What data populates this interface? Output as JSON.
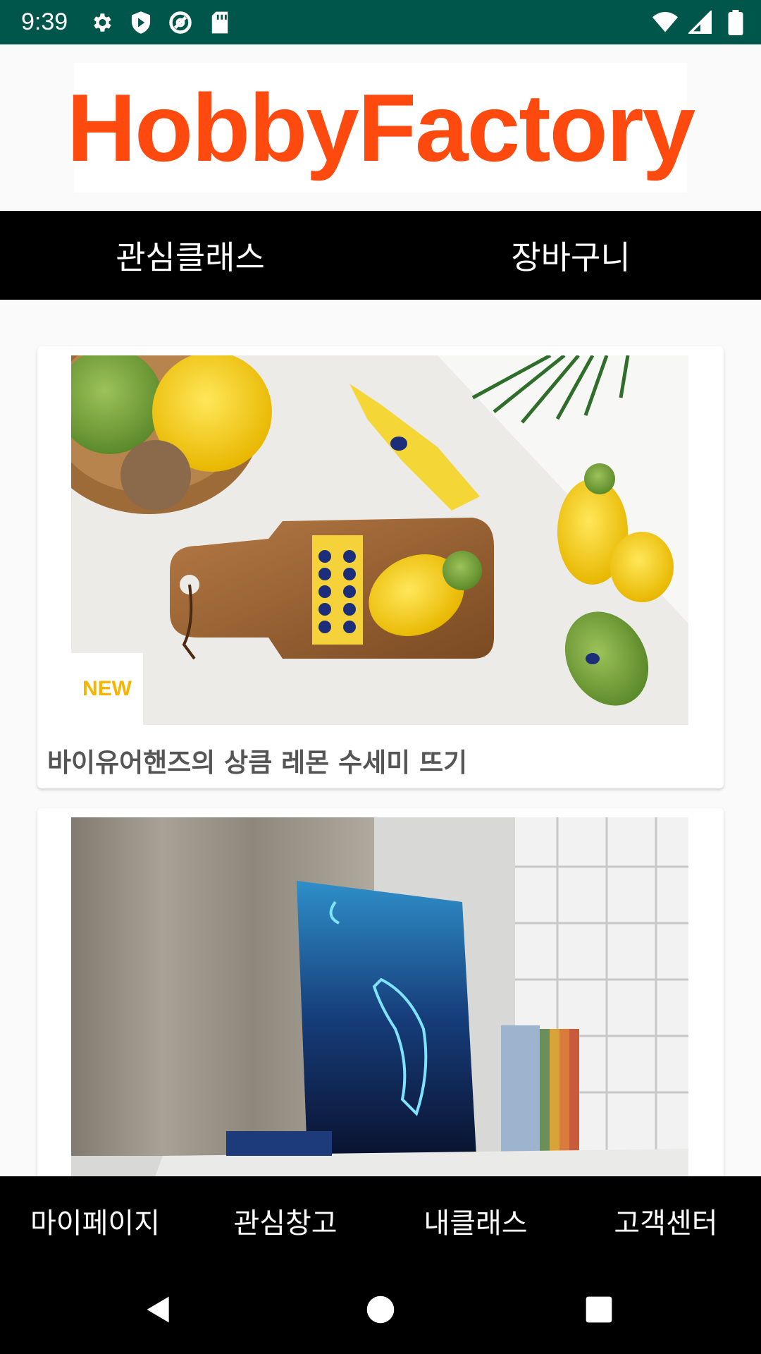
{
  "status_bar": {
    "time": "9:39",
    "left_icons": [
      "settings-icon",
      "play-protect-icon",
      "at-sign-icon",
      "sd-card-icon"
    ],
    "right_icons": [
      "wifi-icon",
      "signal-icon",
      "battery-icon"
    ]
  },
  "header": {
    "logo_text": "HobbyFactory",
    "logo_color": "#ff4a0f"
  },
  "top_tabs": [
    {
      "label": "관심클래스"
    },
    {
      "label": "장바구니"
    }
  ],
  "classes": [
    {
      "title": "바이유어핸즈의 상큼 레몬 수세미 뜨기",
      "badge": "NEW"
    },
    {
      "title": ""
    }
  ],
  "bottom_nav": [
    {
      "label": "마이페이지"
    },
    {
      "label": "관심창고"
    },
    {
      "label": "내클래스"
    },
    {
      "label": "고객센터"
    }
  ],
  "system_nav": [
    "back-icon",
    "home-icon",
    "recents-icon"
  ],
  "colors": {
    "status_bar": "#00564a",
    "tab_bar": "#000000",
    "background": "#fafafa"
  }
}
